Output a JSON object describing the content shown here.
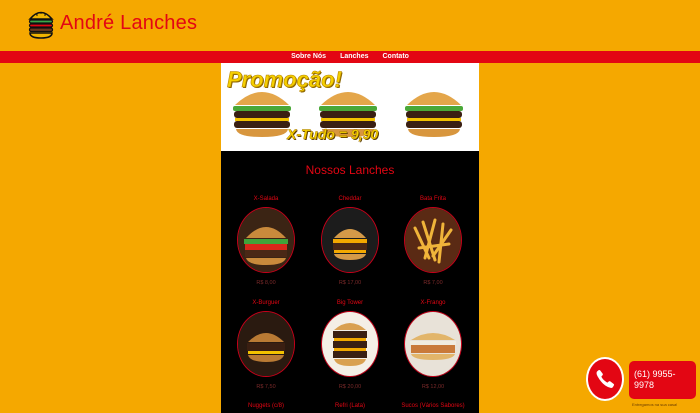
{
  "header": {
    "brand_name": "André Lanches",
    "logo_icon": "burger-logo-icon"
  },
  "nav": [
    {
      "label": "Sobre Nós"
    },
    {
      "label": "Lanches"
    },
    {
      "label": "Contato"
    }
  ],
  "promo": {
    "title": "Promoção!",
    "offer": "X-Tudo = 9,90"
  },
  "section": {
    "title": "Nossos Lanches"
  },
  "products": [
    {
      "name": "X-Salada",
      "price": "R$ 8,00"
    },
    {
      "name": "Cheddar",
      "price": "R$ 17,00"
    },
    {
      "name": "Bata Frita",
      "price": "R$ 7,00"
    },
    {
      "name": "X-Burguer",
      "price": "R$ 7,50"
    },
    {
      "name": "Big Tower",
      "price": "R$ 20,00"
    },
    {
      "name": "X-Frango",
      "price": "R$ 12,00"
    },
    {
      "name": "Nuggets (c/8)",
      "price": ""
    },
    {
      "name": "Refri (Lata)",
      "price": ""
    },
    {
      "name": "Sucos (Vários Sabores)",
      "price": ""
    }
  ],
  "contact": {
    "phone": "(61) 9955-9978",
    "subtitle": "Entregamos na sua casa!",
    "icon": "phone-icon"
  },
  "colors": {
    "background": "#f5a800",
    "accent": "#e30613",
    "panel": "#000000"
  }
}
